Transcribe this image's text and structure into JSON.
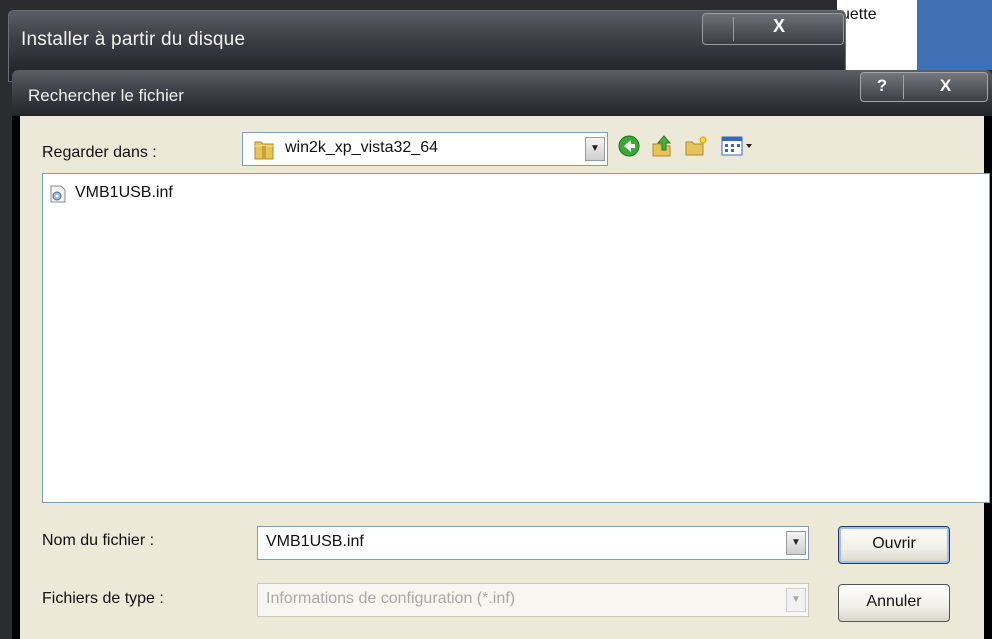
{
  "background": {
    "partial_text": "uette"
  },
  "back_dialog": {
    "title": "Installer à partir du disque",
    "close_label": "X"
  },
  "dialog": {
    "title": "Rechercher le fichier",
    "help_label": "?",
    "close_label": "X",
    "look_in": {
      "label": "Regarder dans :",
      "value": "win2k_xp_vista32_64"
    },
    "toolbar_icons": [
      "back-icon",
      "up-folder-icon",
      "new-folder-icon",
      "view-menu-icon"
    ],
    "files": [
      {
        "name": "VMB1USB.inf",
        "icon": "inf-file-icon"
      }
    ],
    "filename": {
      "label": "Nom du fichier :",
      "value": "VMB1USB.inf"
    },
    "filetype": {
      "label": "Fichiers de type :",
      "value": "Informations de configuration (*.inf)"
    },
    "open_button": "Ouvrir",
    "cancel_button": "Annuler"
  },
  "colors": {
    "titlebar": "#3f4248",
    "client": "#ece9d8",
    "border": "#7f9db9",
    "background_blue": "#3f6fb5"
  }
}
